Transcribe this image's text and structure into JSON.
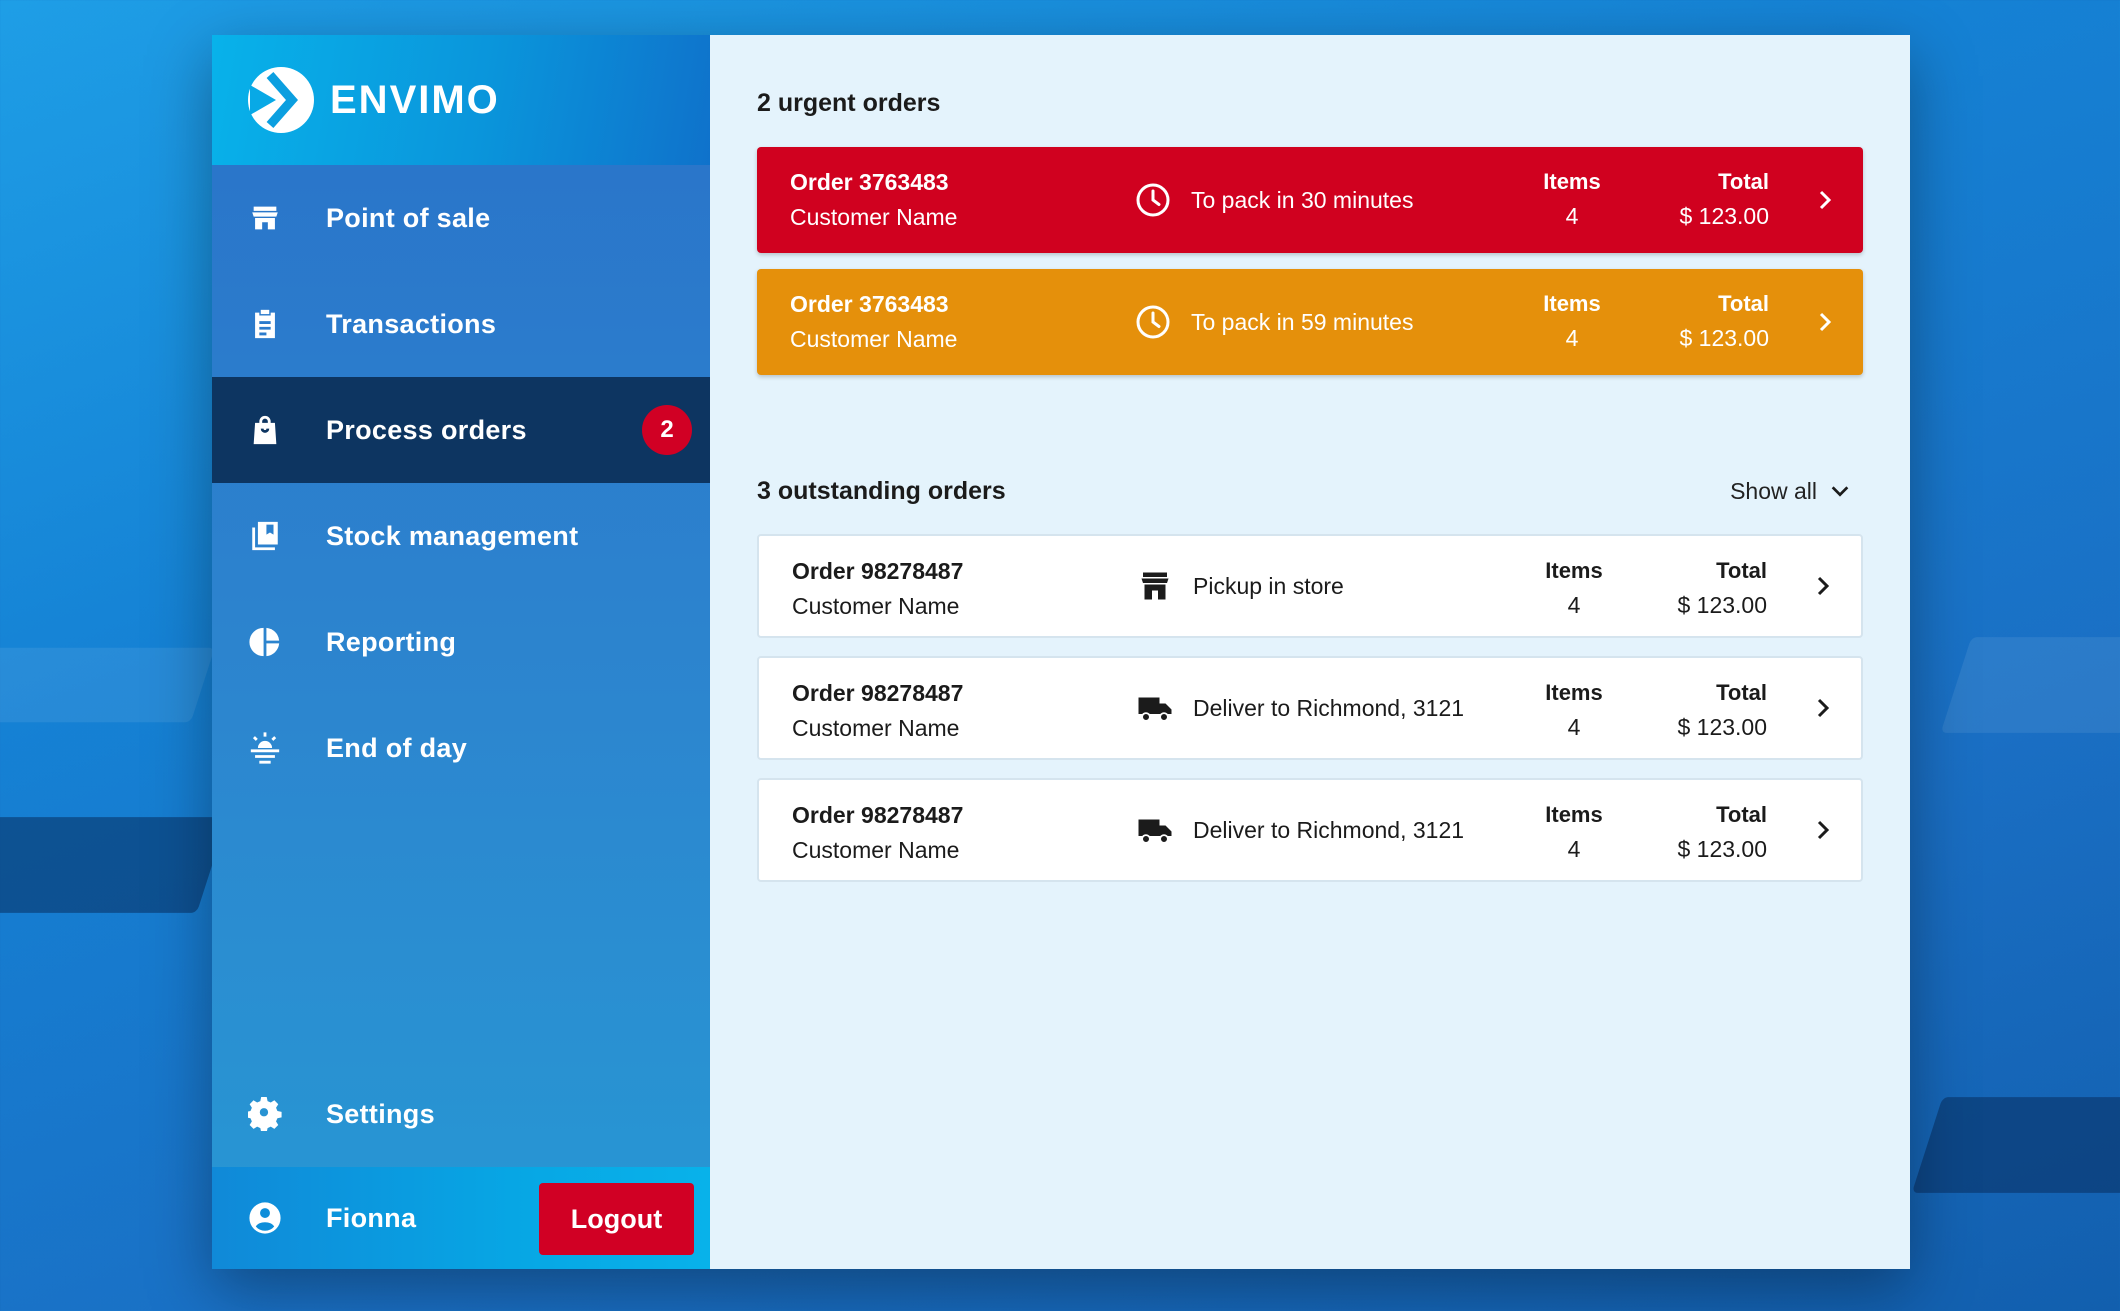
{
  "brand": {
    "name": "ENVIMO"
  },
  "nav": {
    "items": [
      {
        "label": "Point of sale",
        "icon": "store-icon"
      },
      {
        "label": "Transactions",
        "icon": "clipboard-icon"
      },
      {
        "label": "Process orders",
        "icon": "shopping-bag-icon",
        "badge": "2",
        "active": true
      },
      {
        "label": "Stock management",
        "icon": "library-icon"
      },
      {
        "label": "Reporting",
        "icon": "pie-chart-icon"
      },
      {
        "label": "End of day",
        "icon": "sunset-icon"
      }
    ],
    "settings_label": "Settings"
  },
  "user": {
    "name": "Fionna",
    "logout_label": "Logout"
  },
  "urgent": {
    "title": "2 urgent orders",
    "orders": [
      {
        "order": "Order 3763483",
        "customer": "Customer Name",
        "status": "To pack in 30 minutes",
        "items_label": "Items",
        "items": "4",
        "total_label": "Total",
        "total": "$ 123.00",
        "color": "#d0011f"
      },
      {
        "order": "Order 3763483",
        "customer": "Customer Name",
        "status": "To pack in 59 minutes",
        "items_label": "Items",
        "items": "4",
        "total_label": "Total",
        "total": "$ 123.00",
        "color": "#e5900b"
      }
    ]
  },
  "outstanding": {
    "title": "3 outstanding orders",
    "show_all_label": "Show all",
    "orders": [
      {
        "order": "Order 98278487",
        "customer": "Customer Name",
        "status": "Pickup in store",
        "status_icon": "store-icon",
        "items_label": "Items",
        "items": "4",
        "total_label": "Total",
        "total": "$ 123.00"
      },
      {
        "order": "Order 98278487",
        "customer": "Customer Name",
        "status": "Deliver to Richmond, 3121",
        "status_icon": "truck-icon",
        "items_label": "Items",
        "items": "4",
        "total_label": "Total",
        "total": "$ 123.00"
      },
      {
        "order": "Order 98278487",
        "customer": "Customer Name",
        "status": "Deliver to Richmond, 3121",
        "status_icon": "truck-icon",
        "items_label": "Items",
        "items": "4",
        "total_label": "Total",
        "total": "$ 123.00"
      }
    ]
  }
}
